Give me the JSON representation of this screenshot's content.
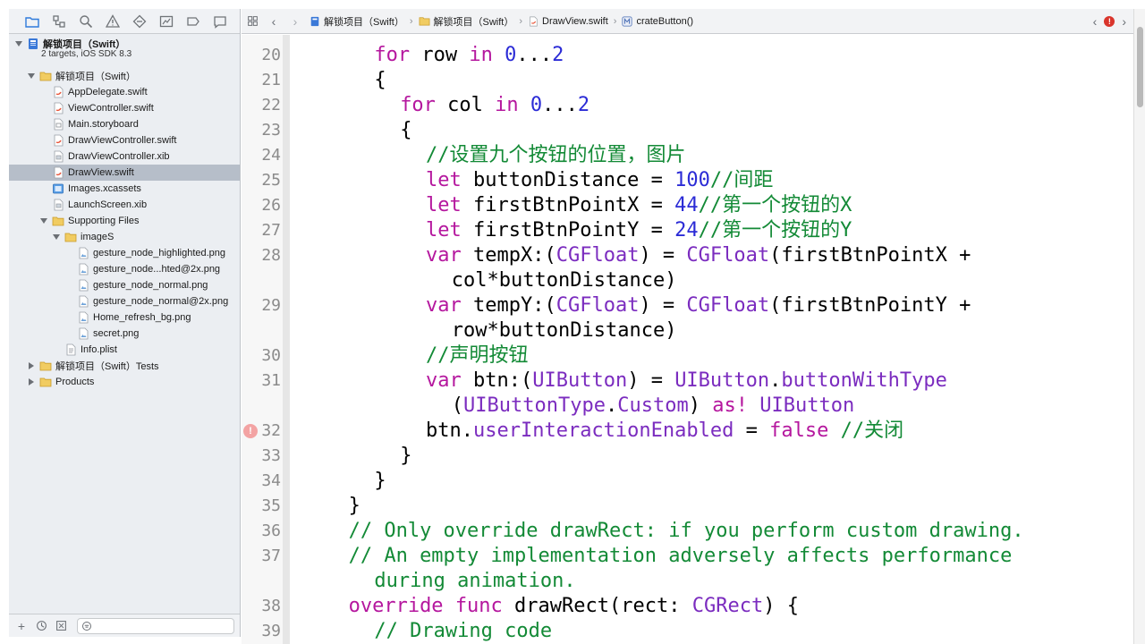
{
  "navigator": {
    "project": {
      "name": "解锁项目（Swift）",
      "subtitle": "2 targets, iOS SDK 8.3"
    },
    "items": [
      {
        "label": "解锁项目（Swift）",
        "indent": 1,
        "disclosure": "open",
        "icon": "folder-icon"
      },
      {
        "label": "AppDelegate.swift",
        "indent": 2,
        "icon": "swift-file-icon"
      },
      {
        "label": "ViewController.swift",
        "indent": 2,
        "icon": "swift-file-icon"
      },
      {
        "label": "Main.storyboard",
        "indent": 2,
        "icon": "storyboard-icon"
      },
      {
        "label": "DrawViewController.swift",
        "indent": 2,
        "icon": "swift-file-icon"
      },
      {
        "label": "DrawViewController.xib",
        "indent": 2,
        "icon": "xib-icon"
      },
      {
        "label": "DrawView.swift",
        "indent": 2,
        "icon": "swift-file-icon",
        "selected": true
      },
      {
        "label": "Images.xcassets",
        "indent": 2,
        "icon": "assets-icon"
      },
      {
        "label": "LaunchScreen.xib",
        "indent": 2,
        "icon": "xib-icon"
      },
      {
        "label": "Supporting Files",
        "indent": 2,
        "disclosure": "open",
        "icon": "folder-icon"
      },
      {
        "label": "imageS",
        "indent": 3,
        "disclosure": "open",
        "icon": "folder-icon"
      },
      {
        "label": "gesture_node_highlighted.png",
        "indent": 4,
        "icon": "image-file-icon"
      },
      {
        "label": "gesture_node...hted@2x.png",
        "indent": 4,
        "icon": "image-file-icon"
      },
      {
        "label": "gesture_node_normal.png",
        "indent": 4,
        "icon": "image-file-icon"
      },
      {
        "label": "gesture_node_normal@2x.png",
        "indent": 4,
        "icon": "image-file-icon"
      },
      {
        "label": "Home_refresh_bg.png",
        "indent": 4,
        "icon": "image-file-icon"
      },
      {
        "label": "secret.png",
        "indent": 4,
        "icon": "image-file-icon"
      },
      {
        "label": "Info.plist",
        "indent": 3,
        "icon": "plist-icon"
      },
      {
        "label": "解锁项目（Swift）Tests",
        "indent": 1,
        "disclosure": "closed",
        "icon": "folder-icon"
      },
      {
        "label": "Products",
        "indent": 1,
        "disclosure": "closed",
        "icon": "folder-icon"
      }
    ]
  },
  "jumpbar": {
    "crumbs": [
      "解锁项目（Swift）",
      "解锁项目（Swift）",
      "DrawView.swift",
      "crateButton()"
    ],
    "error_count": "!"
  },
  "editor": {
    "lines": [
      {
        "num": "20",
        "indent": 6,
        "tokens": [
          [
            "kw",
            "for"
          ],
          [
            "pl",
            " row "
          ],
          [
            "kw",
            "in"
          ],
          [
            "pl",
            " "
          ],
          [
            "nm",
            "0"
          ],
          [
            "pl",
            "..."
          ],
          [
            "nm",
            "2"
          ]
        ]
      },
      {
        "num": "21",
        "indent": 6,
        "tokens": [
          [
            "pl",
            "{"
          ]
        ]
      },
      {
        "num": "22",
        "indent": 8,
        "tokens": [
          [
            "kw",
            "for"
          ],
          [
            "pl",
            " col "
          ],
          [
            "kw",
            "in"
          ],
          [
            "pl",
            " "
          ],
          [
            "nm",
            "0"
          ],
          [
            "pl",
            "..."
          ],
          [
            "nm",
            "2"
          ]
        ]
      },
      {
        "num": "23",
        "indent": 8,
        "tokens": [
          [
            "pl",
            "{"
          ]
        ]
      },
      {
        "num": "24",
        "indent": 10,
        "tokens": [
          [
            "cm",
            "//设置九个按钮的位置，图片"
          ]
        ]
      },
      {
        "num": "25",
        "indent": 10,
        "tokens": [
          [
            "kw",
            "let"
          ],
          [
            "pl",
            " buttonDistance = "
          ],
          [
            "nm",
            "100"
          ],
          [
            "cm",
            "//间距"
          ]
        ]
      },
      {
        "num": "26",
        "indent": 10,
        "tokens": [
          [
            "kw",
            "let"
          ],
          [
            "pl",
            " firstBtnPointX = "
          ],
          [
            "nm",
            "44"
          ],
          [
            "cm",
            "//第一个按钮的X"
          ]
        ]
      },
      {
        "num": "27",
        "indent": 10,
        "tokens": [
          [
            "kw",
            "let"
          ],
          [
            "pl",
            " firstBtnPointY = "
          ],
          [
            "nm",
            "24"
          ],
          [
            "cm",
            "//第一个按钮的Y"
          ]
        ]
      },
      {
        "num": "28",
        "indent": 10,
        "tokens": [
          [
            "kw",
            "var"
          ],
          [
            "pl",
            " tempX:("
          ],
          [
            "ty",
            "CGFloat"
          ],
          [
            "pl",
            ") = "
          ],
          [
            "ty",
            "CGFloat"
          ],
          [
            "pl",
            "(firstBtnPointX +"
          ]
        ]
      },
      {
        "num": "",
        "indent": 12,
        "tokens": [
          [
            "pl",
            "col*buttonDistance)"
          ]
        ]
      },
      {
        "num": "29",
        "indent": 10,
        "tokens": [
          [
            "kw",
            "var"
          ],
          [
            "pl",
            " tempY:("
          ],
          [
            "ty",
            "CGFloat"
          ],
          [
            "pl",
            ") = "
          ],
          [
            "ty",
            "CGFloat"
          ],
          [
            "pl",
            "(firstBtnPointY +"
          ]
        ]
      },
      {
        "num": "",
        "indent": 12,
        "tokens": [
          [
            "pl",
            "row*buttonDistance)"
          ]
        ]
      },
      {
        "num": "30",
        "indent": 10,
        "tokens": [
          [
            "cm",
            "//声明按钮"
          ]
        ]
      },
      {
        "num": "31",
        "indent": 10,
        "tokens": [
          [
            "kw",
            "var"
          ],
          [
            "pl",
            " btn:("
          ],
          [
            "ty",
            "UIButton"
          ],
          [
            "pl",
            ") = "
          ],
          [
            "ty",
            "UIButton"
          ],
          [
            "pl",
            "."
          ],
          [
            "ty",
            "buttonWithType"
          ]
        ]
      },
      {
        "num": "",
        "indent": 12,
        "tokens": [
          [
            "pl",
            "("
          ],
          [
            "ty",
            "UIButtonType"
          ],
          [
            "pl",
            "."
          ],
          [
            "ty",
            "Custom"
          ],
          [
            "pl",
            ") "
          ],
          [
            "kw",
            "as!"
          ],
          [
            "pl",
            " "
          ],
          [
            "ty",
            "UIButton"
          ]
        ]
      },
      {
        "num": "32",
        "indent": 10,
        "error": true,
        "tokens": [
          [
            "pl",
            "btn."
          ],
          [
            "ty",
            "userInteractionEnabled"
          ],
          [
            "pl",
            " = "
          ],
          [
            "kw",
            "false"
          ],
          [
            "pl",
            " "
          ],
          [
            "cm",
            "//关闭"
          ]
        ]
      },
      {
        "num": "33",
        "indent": 8,
        "tokens": [
          [
            "pl",
            "}"
          ]
        ]
      },
      {
        "num": "34",
        "indent": 6,
        "tokens": [
          [
            "pl",
            "}"
          ]
        ]
      },
      {
        "num": "35",
        "indent": 4,
        "tokens": [
          [
            "pl",
            "}"
          ]
        ]
      },
      {
        "num": "36",
        "indent": 4,
        "tokens": [
          [
            "cm",
            "// Only override drawRect: if you perform custom drawing."
          ]
        ]
      },
      {
        "num": "37",
        "indent": 4,
        "tokens": [
          [
            "cm",
            "// An empty implementation adversely affects performance"
          ]
        ]
      },
      {
        "num": "",
        "indent": 6,
        "tokens": [
          [
            "cm",
            "during animation."
          ]
        ]
      },
      {
        "num": "38",
        "indent": 4,
        "tokens": [
          [
            "kw",
            "override"
          ],
          [
            "pl",
            " "
          ],
          [
            "kw",
            "func"
          ],
          [
            "pl",
            " drawRect(rect: "
          ],
          [
            "ty",
            "CGRect"
          ],
          [
            "pl",
            ") {"
          ]
        ]
      },
      {
        "num": "39",
        "indent": 6,
        "tokens": [
          [
            "cm",
            "// Drawing code"
          ]
        ]
      }
    ]
  },
  "colors": {
    "keyword": "#b5179e",
    "type": "#7b2cbf",
    "number": "#2b2bd6",
    "comment": "#138a36",
    "selection": "#b6bec9"
  }
}
